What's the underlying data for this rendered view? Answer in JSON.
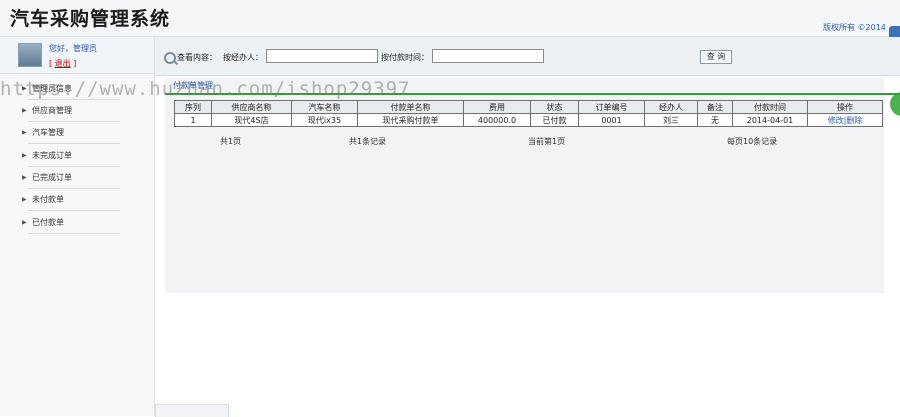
{
  "header": {
    "title": "汽车采购管理系统",
    "copyright": "版权所有 ©2014"
  },
  "user": {
    "greeting": "您好，管理员",
    "logout_label": "退出"
  },
  "sidebar": {
    "items": [
      {
        "label": "管理员信息"
      },
      {
        "label": "供应商管理"
      },
      {
        "label": "汽车管理"
      },
      {
        "label": "未完成订单"
      },
      {
        "label": "已完成订单"
      },
      {
        "label": "未付款单"
      },
      {
        "label": "已付款单"
      }
    ]
  },
  "search": {
    "section_label": "查看内容：",
    "operator_label": "按经办人：",
    "operator_value": "",
    "time_label": "按付款时间：",
    "time_value": "",
    "button_label": "查 询"
  },
  "panel": {
    "title": "付款单管理"
  },
  "table": {
    "headers": [
      "序列",
      "供应商名称",
      "汽车名称",
      "付款单名称",
      "费用",
      "状态",
      "订单编号",
      "经办人",
      "备注",
      "付款时间",
      "操作"
    ],
    "rows": [
      {
        "cells": [
          "1",
          "现代4S店",
          "现代ix35",
          "现代采购付款单",
          "400000.0",
          "已付款",
          "0001",
          "刘三",
          "无",
          "2014-04-01"
        ],
        "edit_label": "修改",
        "delete_label": "删除"
      }
    ]
  },
  "pager": {
    "total_pages": "共1页",
    "total_records": "共1条记录",
    "current_page": "当前第1页",
    "per_page": "每页10条记录"
  },
  "watermark": {
    "text": "https://www.huzhan.com/ishop29397"
  },
  "colors": {
    "accent": "#2a5db0",
    "divider": "#3a9a3a",
    "logout": "#c00000"
  }
}
